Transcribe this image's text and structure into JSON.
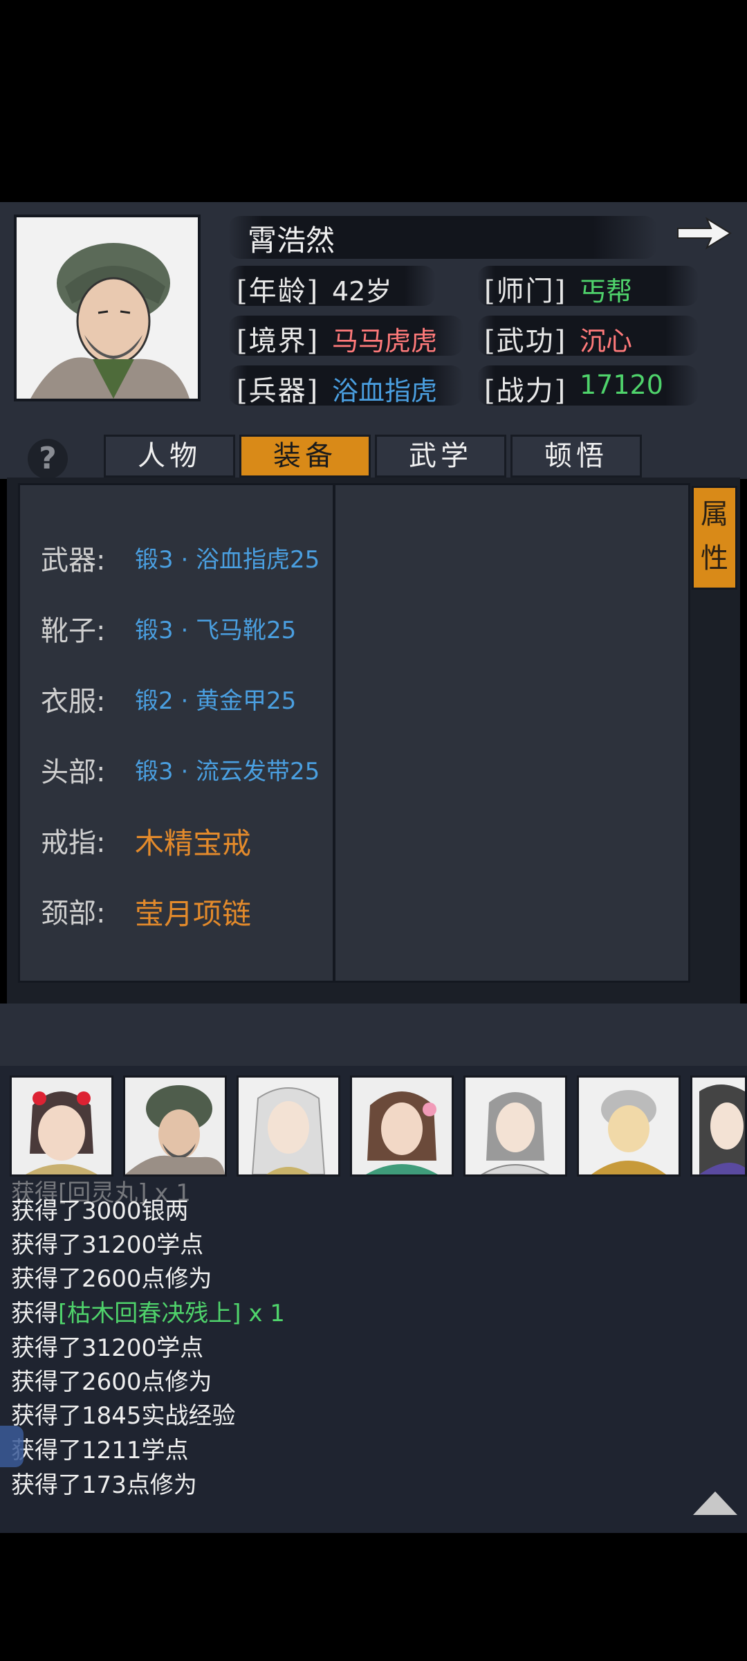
{
  "character": {
    "name": "霄浩然",
    "age_label": "[年龄]",
    "age": "42岁",
    "sect_label": "[师门]",
    "sect": "丐帮",
    "realm_label": "[境界]",
    "realm": "马马虎虎",
    "skill_label": "[武功]",
    "skill": "沉心",
    "weapon_label": "[兵器]",
    "weapon": "浴血指虎",
    "power_label": "[战力]",
    "power": "17120"
  },
  "help_label": "?",
  "tabs": [
    {
      "label": "人物",
      "active": false
    },
    {
      "label": "装备",
      "active": true
    },
    {
      "label": "武学",
      "active": false
    },
    {
      "label": "顿悟",
      "active": false
    }
  ],
  "side_tab": {
    "line1": "属",
    "line2": "性"
  },
  "equipment": [
    {
      "slot": "武器:",
      "item": "锻3 · 浴血指虎25",
      "color": "#4a9fe0"
    },
    {
      "slot": "靴子:",
      "item": "锻3 · 飞马靴25",
      "color": "#4a9fe0"
    },
    {
      "slot": "衣服:",
      "item": "锻2 · 黄金甲25",
      "color": "#4a9fe0"
    },
    {
      "slot": "头部:",
      "item": "锻3 · 流云发带25",
      "color": "#4a9fe0"
    },
    {
      "slot": "戒指:",
      "item": "木精宝戒",
      "color": "#e38a2b"
    },
    {
      "slot": "颈部:",
      "item": "莹月项链",
      "color": "#e38a2b"
    }
  ],
  "colors": {
    "sect": "#4fd36b",
    "skill": "#ff7a7a",
    "realm": "#ff7a7a",
    "weapon": "#4a9fe0",
    "power": "#4fd36b",
    "accent": "#d98a18",
    "log_highlight": "#4fd36b"
  },
  "party_icons": [
    "girl-portrait-icon",
    "beggar-portrait-icon",
    "white-hair-portrait-icon",
    "lady-portrait-icon",
    "swordsman-portrait-icon",
    "monk-portrait-icon",
    "scholar-portrait-icon"
  ],
  "log": {
    "partial_top": "获得[回灵丸] x 1",
    "lines": [
      {
        "prefix": "获得了3000银两",
        "highlight": "",
        "suffix": ""
      },
      {
        "prefix": "获得了31200学点",
        "highlight": "",
        "suffix": ""
      },
      {
        "prefix": "获得了2600点修为",
        "highlight": "",
        "suffix": ""
      },
      {
        "prefix": "获得",
        "highlight": "[枯木回春决残上]",
        "suffix": " x 1"
      },
      {
        "prefix": "获得了31200学点",
        "highlight": "",
        "suffix": ""
      },
      {
        "prefix": "获得了2600点修为",
        "highlight": "",
        "suffix": ""
      },
      {
        "prefix": "获得了1845实战经验",
        "highlight": "",
        "suffix": ""
      },
      {
        "prefix": "获得了1211学点",
        "highlight": "",
        "suffix": ""
      },
      {
        "prefix": "获得了173点修为",
        "highlight": "",
        "suffix": ""
      }
    ]
  }
}
